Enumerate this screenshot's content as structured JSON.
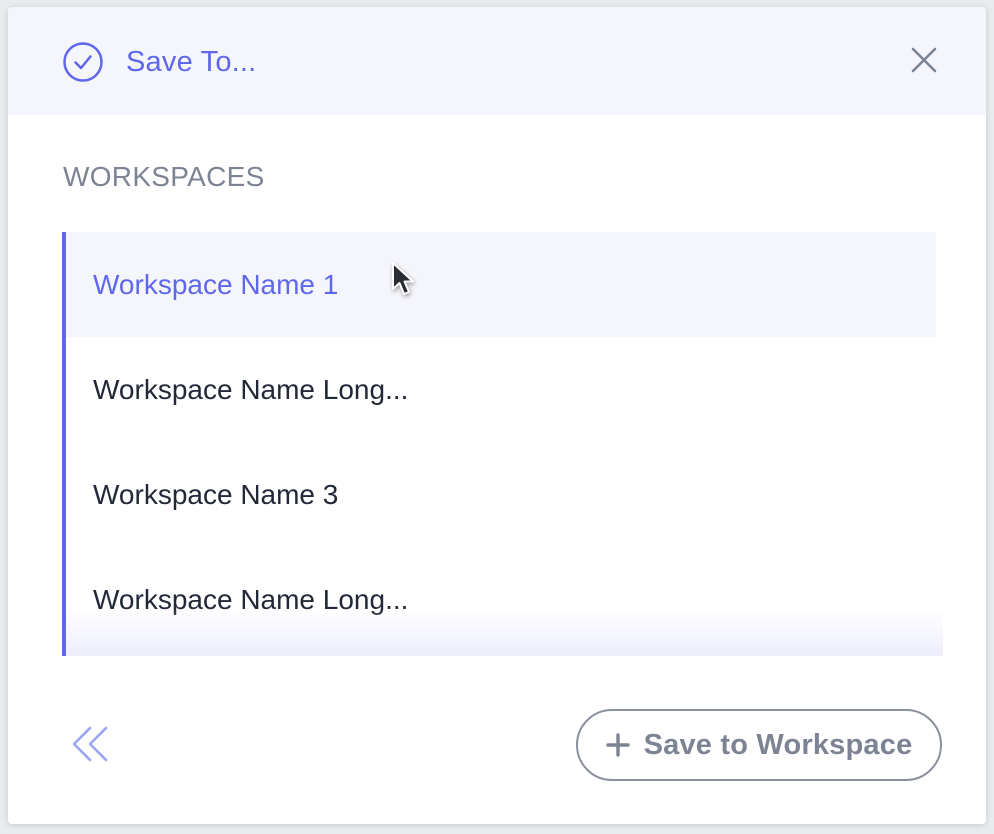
{
  "header": {
    "title": "Save To...",
    "check_icon": "check-circle-icon",
    "close_icon": "close-icon"
  },
  "section": {
    "label": "WORKSPACES"
  },
  "workspaces": [
    {
      "label": "Workspace Name 1",
      "selected": true
    },
    {
      "label": "Workspace Name Long...",
      "selected": false
    },
    {
      "label": "Workspace Name 3",
      "selected": false
    },
    {
      "label": "Workspace Name Long...",
      "selected": false
    }
  ],
  "footer": {
    "back_icon": "double-chevron-left-icon",
    "save_icon": "plus-icon",
    "save_label": "Save to Workspace"
  },
  "colors": {
    "accent": "#5f67ec",
    "header_bg": "#f5f5fc",
    "text_dark": "#232838",
    "text_muted": "#7c8494"
  }
}
